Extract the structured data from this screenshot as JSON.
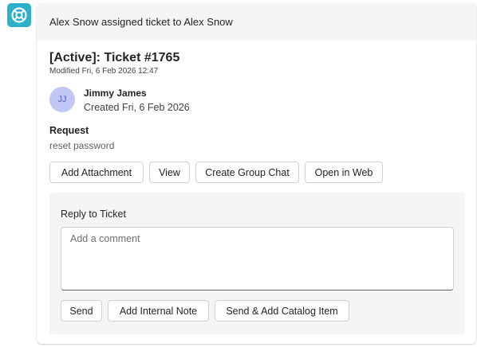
{
  "app": {
    "icon": "lifebuoy-icon",
    "accent_color": "#2bb0c7"
  },
  "card": {
    "header_text": "Alex Snow assigned ticket to Alex Snow",
    "ticket_title": "[Active]: Ticket #1765",
    "modified": "Modified Fri, 6 Feb 2026 12:47",
    "person": {
      "initials": "JJ",
      "name": "Jimmy James",
      "created": "Created Fri, 6 Feb 2026",
      "avatar_color": "#c1c6f5"
    },
    "request": {
      "label": "Request",
      "value": "reset password"
    },
    "actions": {
      "add_attachment": "Add Attachment",
      "view": "View",
      "create_group_chat": "Create Group Chat",
      "open_in_web": "Open in Web"
    },
    "reply": {
      "label": "Reply to Ticket",
      "placeholder": "Add a comment",
      "value": "",
      "send": "Send",
      "add_internal_note": "Add Internal Note",
      "send_add_catalog": "Send & Add Catalog Item"
    }
  }
}
